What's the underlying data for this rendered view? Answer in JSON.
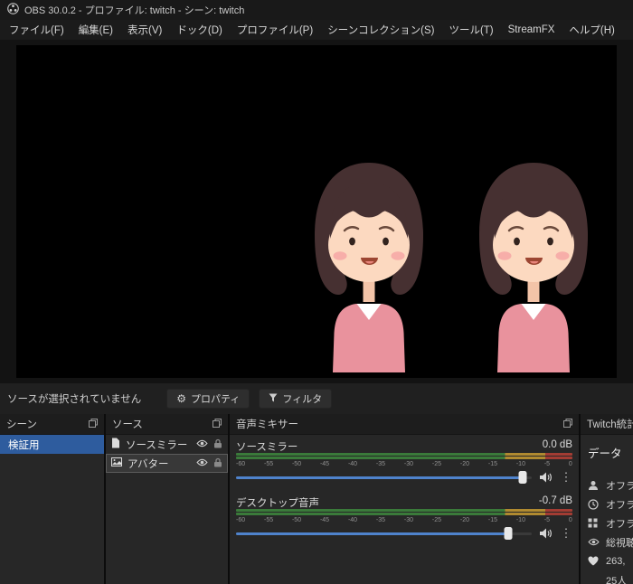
{
  "window": {
    "title": "OBS 30.0.2 - プロファイル: twitch - シーン: twitch"
  },
  "menu": {
    "items": [
      "ファイル(F)",
      "編集(E)",
      "表示(V)",
      "ドック(D)",
      "プロファイル(P)",
      "シーンコレクション(S)",
      "ツール(T)",
      "StreamFX",
      "ヘルプ(H)"
    ]
  },
  "control_bar": {
    "status_text": "ソースが選択されていません",
    "properties_label": "プロパティ",
    "filters_label": "フィルタ"
  },
  "scenes_dock": {
    "title": "シーン",
    "items": [
      {
        "label": "検証用",
        "selected": true
      }
    ]
  },
  "sources_dock": {
    "title": "ソース",
    "items": [
      {
        "label": "ソースミラー",
        "icon": "document-source-icon",
        "visible": true,
        "locked": true
      },
      {
        "label": "アバター",
        "icon": "image-source-icon",
        "visible": true,
        "locked": true,
        "selected": true
      }
    ]
  },
  "mixer_dock": {
    "title": "音声ミキサー",
    "scale_labels": [
      "-60",
      "-55",
      "-50",
      "-45",
      "-40",
      "-35",
      "-30",
      "-25",
      "-20",
      "-15",
      "-10",
      "-5",
      "0"
    ],
    "channels": [
      {
        "name": "ソースミラー",
        "db": "0.0 dB",
        "slider_pct": 97
      },
      {
        "name": "デスクトップ音声",
        "db": "-0.7 dB",
        "slider_pct": 92
      }
    ]
  },
  "twitch_dock": {
    "title": "Twitch統計情報",
    "section_label": "データ",
    "rows": [
      {
        "icon": "person-icon",
        "text": "オフライン"
      },
      {
        "icon": "clock-icon",
        "text": "オフライン"
      },
      {
        "icon": "grid-icon",
        "text": "オフライン"
      },
      {
        "icon": "eye-icon",
        "text": "総視聴者数"
      },
      {
        "icon": "heart-icon",
        "text": "263,"
      },
      {
        "icon": "",
        "text": "25人"
      }
    ]
  },
  "colors": {
    "selection_blue": "#2e5c9e",
    "slider_blue": "#4f83cc",
    "meter_green": "#3a7a3a",
    "meter_yellow": "#b08a30",
    "meter_red": "#a33c33"
  }
}
